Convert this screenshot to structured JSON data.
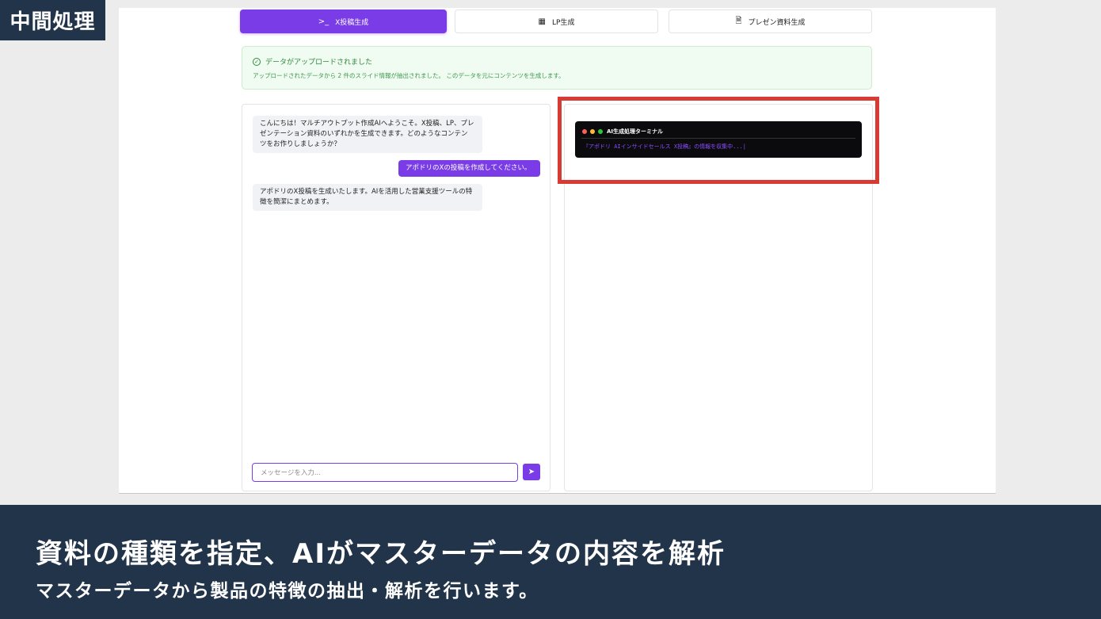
{
  "badge": "中間処理",
  "tabs": [
    {
      "label": "X投稿生成",
      "icon": "terminal-icon",
      "active": true
    },
    {
      "label": "LP生成",
      "icon": "layout-icon",
      "active": false
    },
    {
      "label": "プレゼン資料生成",
      "icon": "document-icon",
      "active": false
    }
  ],
  "notice": {
    "title": "データがアップロードされました",
    "detail": "アップロードされたデータから 2 件のスライド情報が抽出されました。 このデータを元にコンテンツを生成します。"
  },
  "chat": {
    "messages": [
      {
        "role": "bot",
        "lines": [
          "こんにちは！マルチアウトプット作成AIへようこそ。X投稿、LP、プレ",
          "ゼンテーション資料のいずれかを生成できます。どのようなコンテン",
          "ツをお作りしましょうか？"
        ]
      },
      {
        "role": "user",
        "text": "アポドリのXの投稿を作成してください。"
      },
      {
        "role": "bot",
        "lines": [
          "アポドリのX投稿を生成いたします。AIを活用した営業支援ツールの特",
          "徴を簡潔にまとめます。"
        ]
      }
    ],
    "input_placeholder": "メッセージを入力..."
  },
  "terminal": {
    "title": "AI生成処理ターミナル",
    "output": "『アポドリ AIインサイドセールス X投稿』の情報を収集中...|",
    "dot_colors": [
      "#ff5f57",
      "#febc2e",
      "#28c840"
    ]
  },
  "caption": {
    "headline": "資料の種類を指定、AIがマスターデータの内容を解析",
    "subline": "マスターデータから製品の特徴の抽出・解析を行います。"
  },
  "colors": {
    "accent": "#7a3ce6",
    "highlight": "#d83b34",
    "navy": "#223449"
  }
}
